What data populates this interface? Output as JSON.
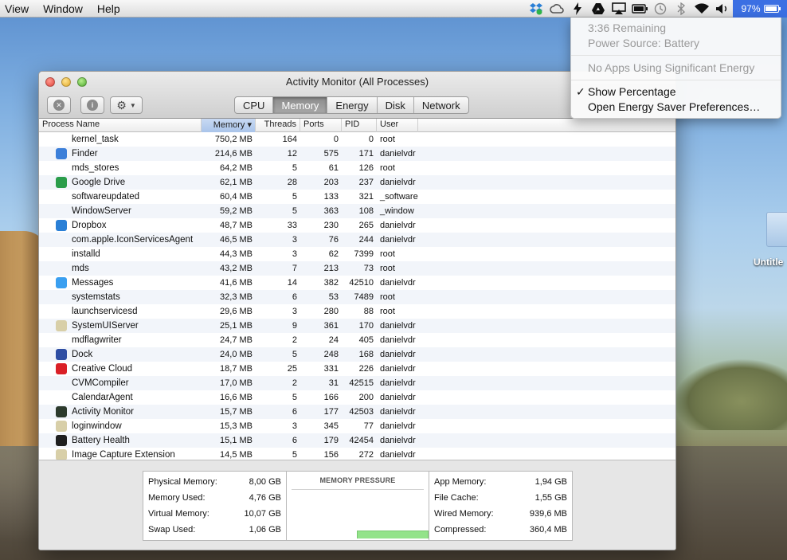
{
  "menubar": {
    "items": [
      "View",
      "Window",
      "Help"
    ],
    "battery_percent_label": "97%",
    "battery_level": 0.97,
    "icons": [
      "dropbox-icon",
      "creative-cloud-icon",
      "bolt-icon",
      "google-drive-icon",
      "airplay-icon",
      "battery-health-icon",
      "time-machine-icon",
      "bluetooth-icon",
      "wifi-icon",
      "volume-icon"
    ]
  },
  "battery_menu": {
    "remaining": "3:36 Remaining",
    "source": "Power Source: Battery",
    "no_apps": "No Apps Using Significant Energy",
    "check": "✓",
    "show_percentage": "Show Percentage",
    "open_prefs": "Open Energy Saver Preferences…"
  },
  "window": {
    "title": "Activity Monitor (All Processes)",
    "tabs": [
      "CPU",
      "Memory",
      "Energy",
      "Disk",
      "Network"
    ],
    "active_tab": "Memory",
    "columns": {
      "name": "Process Name",
      "memory": "Memory ▾",
      "threads": "Threads",
      "ports": "Ports",
      "pid": "PID",
      "user": "User"
    },
    "processes": [
      {
        "name": "kernel_task",
        "memory": "750,2 MB",
        "threads": "164",
        "ports": "0",
        "pid": "0",
        "user": "root",
        "icon": "",
        "color": ""
      },
      {
        "name": "Finder",
        "memory": "214,6 MB",
        "threads": "12",
        "ports": "575",
        "pid": "171",
        "user": "danielvdr",
        "icon": "finder-icon",
        "color": "#3c7fd9"
      },
      {
        "name": "mds_stores",
        "memory": "64,2 MB",
        "threads": "5",
        "ports": "61",
        "pid": "126",
        "user": "root",
        "icon": "",
        "color": ""
      },
      {
        "name": "Google Drive",
        "memory": "62,1 MB",
        "threads": "28",
        "ports": "203",
        "pid": "237",
        "user": "danielvdr",
        "icon": "google-drive-icon",
        "color": "#2a9d4a"
      },
      {
        "name": "softwareupdated",
        "memory": "60,4 MB",
        "threads": "5",
        "ports": "133",
        "pid": "321",
        "user": "_software",
        "icon": "",
        "color": ""
      },
      {
        "name": "WindowServer",
        "memory": "59,2 MB",
        "threads": "5",
        "ports": "363",
        "pid": "108",
        "user": "_window",
        "icon": "",
        "color": ""
      },
      {
        "name": "Dropbox",
        "memory": "48,7 MB",
        "threads": "33",
        "ports": "230",
        "pid": "265",
        "user": "danielvdr",
        "icon": "dropbox-icon",
        "color": "#2a7fd6"
      },
      {
        "name": "com.apple.IconServicesAgent",
        "memory": "46,5 MB",
        "threads": "3",
        "ports": "76",
        "pid": "244",
        "user": "danielvdr",
        "icon": "",
        "color": ""
      },
      {
        "name": "installd",
        "memory": "44,3 MB",
        "threads": "3",
        "ports": "62",
        "pid": "7399",
        "user": "root",
        "icon": "",
        "color": ""
      },
      {
        "name": "mds",
        "memory": "43,2 MB",
        "threads": "7",
        "ports": "213",
        "pid": "73",
        "user": "root",
        "icon": "",
        "color": ""
      },
      {
        "name": "Messages",
        "memory": "41,6 MB",
        "threads": "14",
        "ports": "382",
        "pid": "42510",
        "user": "danielvdr",
        "icon": "messages-icon",
        "color": "#3a9ff0"
      },
      {
        "name": "systemstats",
        "memory": "32,3 MB",
        "threads": "6",
        "ports": "53",
        "pid": "7489",
        "user": "root",
        "icon": "",
        "color": ""
      },
      {
        "name": "launchservicesd",
        "memory": "29,6 MB",
        "threads": "3",
        "ports": "280",
        "pid": "88",
        "user": "root",
        "icon": "",
        "color": ""
      },
      {
        "name": "SystemUIServer",
        "memory": "25,1 MB",
        "threads": "9",
        "ports": "361",
        "pid": "170",
        "user": "danielvdr",
        "icon": "system-ui-server-icon",
        "color": "#d8cfa8"
      },
      {
        "name": "mdflagwriter",
        "memory": "24,7 MB",
        "threads": "2",
        "ports": "24",
        "pid": "405",
        "user": "danielvdr",
        "icon": "",
        "color": ""
      },
      {
        "name": "Dock",
        "memory": "24,0 MB",
        "threads": "5",
        "ports": "248",
        "pid": "168",
        "user": "danielvdr",
        "icon": "dock-icon",
        "color": "#2f4ea3"
      },
      {
        "name": "Creative Cloud",
        "memory": "18,7 MB",
        "threads": "25",
        "ports": "331",
        "pid": "226",
        "user": "danielvdr",
        "icon": "creative-cloud-icon",
        "color": "#da1f26"
      },
      {
        "name": "CVMCompiler",
        "memory": "17,0 MB",
        "threads": "2",
        "ports": "31",
        "pid": "42515",
        "user": "danielvdr",
        "icon": "",
        "color": ""
      },
      {
        "name": "CalendarAgent",
        "memory": "16,6 MB",
        "threads": "5",
        "ports": "166",
        "pid": "200",
        "user": "danielvdr",
        "icon": "",
        "color": ""
      },
      {
        "name": "Activity Monitor",
        "memory": "15,7 MB",
        "threads": "6",
        "ports": "177",
        "pid": "42503",
        "user": "danielvdr",
        "icon": "activity-monitor-icon",
        "color": "#2c3a2c"
      },
      {
        "name": "loginwindow",
        "memory": "15,3 MB",
        "threads": "3",
        "ports": "345",
        "pid": "77",
        "user": "danielvdr",
        "icon": "loginwindow-icon",
        "color": "#d8cfa8"
      },
      {
        "name": "Battery Health",
        "memory": "15,1 MB",
        "threads": "6",
        "ports": "179",
        "pid": "42454",
        "user": "danielvdr",
        "icon": "battery-health-icon",
        "color": "#1f1f1f"
      },
      {
        "name": "Image Capture Extension",
        "memory": "14,5 MB",
        "threads": "5",
        "ports": "156",
        "pid": "272",
        "user": "danielvdr",
        "icon": "image-capture-icon",
        "color": "#d8cfa8"
      }
    ],
    "memory_stats": {
      "left": [
        {
          "label": "Physical Memory:",
          "value": "8,00 GB"
        },
        {
          "label": "Memory Used:",
          "value": "4,76 GB"
        },
        {
          "label": "Virtual Memory:",
          "value": "10,07 GB"
        },
        {
          "label": "Swap Used:",
          "value": "1,06 GB"
        }
      ],
      "right": [
        {
          "label": "App Memory:",
          "value": "1,94 GB"
        },
        {
          "label": "File Cache:",
          "value": "1,55 GB"
        },
        {
          "label": "Wired Memory:",
          "value": "939,6 MB"
        },
        {
          "label": "Compressed:",
          "value": "360,4 MB"
        }
      ],
      "pressure_title": "MEMORY PRESSURE",
      "pressure_level": 0.12,
      "pressure_color": "#93e38a"
    }
  },
  "desktop": {
    "folder_label": "Untitle"
  }
}
